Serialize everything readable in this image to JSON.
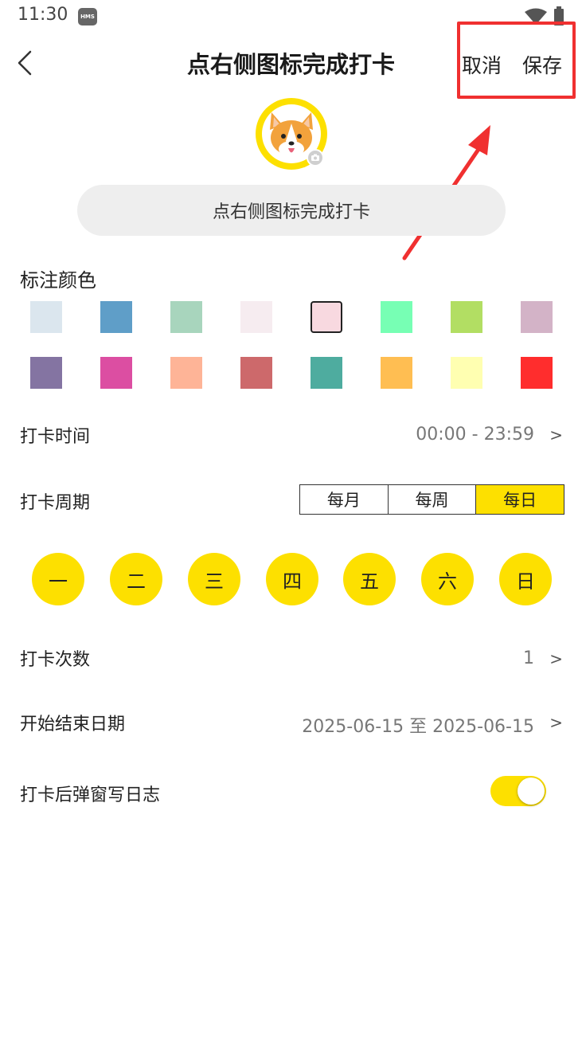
{
  "status_bar": {
    "time": "11:30",
    "hms_label": "HMS"
  },
  "header": {
    "title": "点右侧图标完成打卡",
    "cancel_label": "取消",
    "save_label": "保存"
  },
  "habit_name": {
    "value": "点右侧图标完成打卡"
  },
  "color_section": {
    "label": "标注颜色",
    "colors": [
      "#dbe6ee",
      "#5f9ec8",
      "#a8d5bd",
      "#f6ecf0",
      "#f8d9e0",
      "#77ffb4",
      "#b2de63",
      "#d3b3c7",
      "#8474a2",
      "#dc4ea2",
      "#feb497",
      "#cd696b",
      "#4eac9f",
      "#ffbe52",
      "#ffffb1",
      "#ff2d2d"
    ],
    "selected_index": 4
  },
  "checkin_time": {
    "label": "打卡时间",
    "value": "00:00 - 23:59",
    "chevron": ">"
  },
  "checkin_period": {
    "label": "打卡周期",
    "options": [
      "每月",
      "每周",
      "每日"
    ],
    "selected": "每日"
  },
  "weekdays": [
    "一",
    "二",
    "三",
    "四",
    "五",
    "六",
    "日"
  ],
  "checkin_count": {
    "label": "打卡次数",
    "value": "1",
    "chevron": ">"
  },
  "date_range": {
    "label": "开始结束日期",
    "value": "2025-06-15 至 2025-06-15",
    "chevron": ">"
  },
  "journal_popup": {
    "label": "打卡后弹窗写日志",
    "enabled": true
  },
  "accent_color": "#fde000",
  "annotation_color": "#f03030"
}
